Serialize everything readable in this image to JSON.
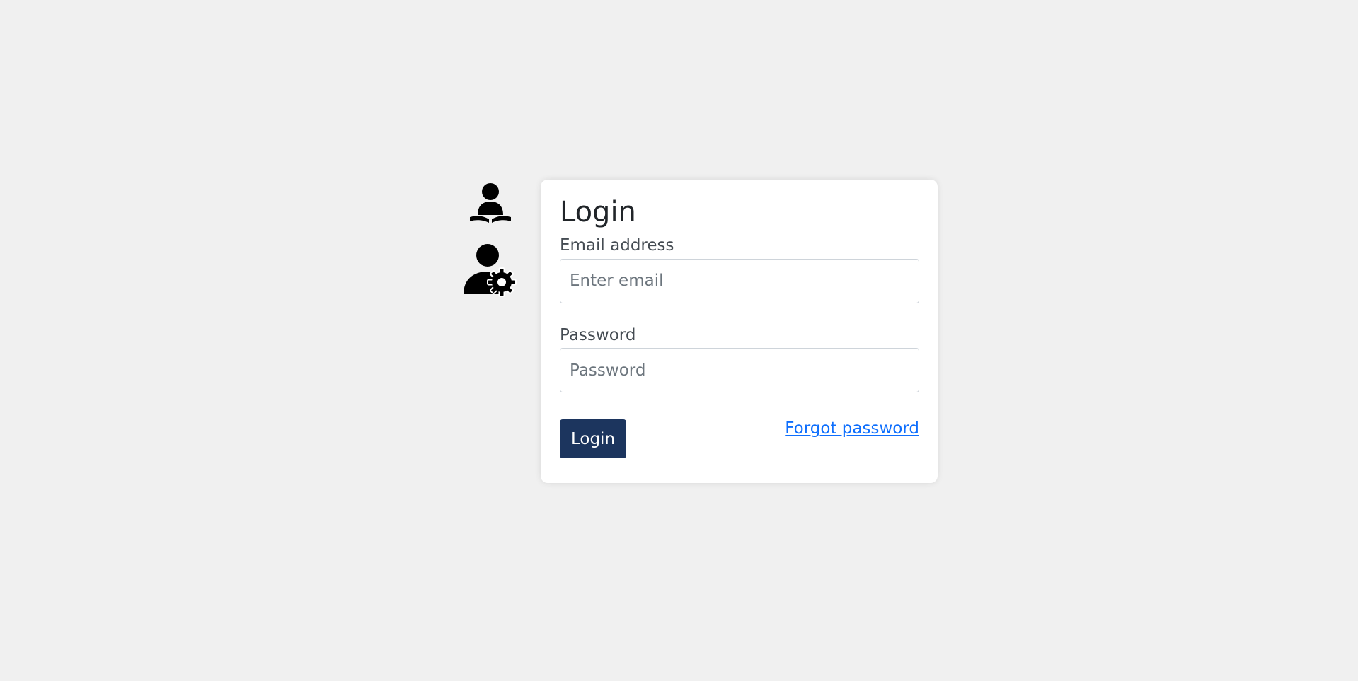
{
  "role_switcher": {
    "items": [
      {
        "icon": "user-reading-icon",
        "role": "student"
      },
      {
        "icon": "user-gear-icon",
        "role": "admin"
      }
    ]
  },
  "login_form": {
    "title": "Login",
    "email": {
      "label": "Email address",
      "value": "",
      "placeholder": "Enter email"
    },
    "password": {
      "label": "Password",
      "value": "",
      "placeholder": "Password"
    },
    "submit_label": "Login",
    "forgot_label": "Forgot password"
  },
  "colors": {
    "background": "#f0f0f0",
    "card": "#ffffff",
    "primary_button": "#1c355e",
    "link": "#0d6efd",
    "icon": "#000000"
  }
}
